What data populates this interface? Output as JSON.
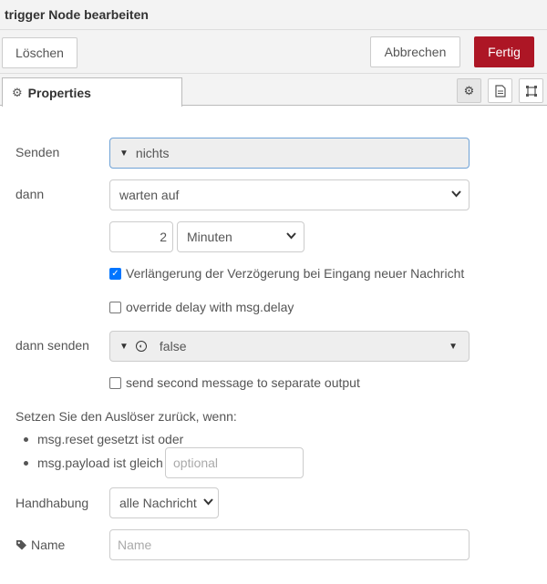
{
  "window": {
    "title": "trigger Node bearbeiten"
  },
  "toolbar": {
    "delete_label": "Löschen",
    "cancel_label": "Abbrechen",
    "done_label": "Fertig",
    "done_color": "#ad1625"
  },
  "tabs": {
    "properties_label": "Properties"
  },
  "form": {
    "send_label": "Senden",
    "send_value": "nichts",
    "then_label": "dann",
    "then_value": "warten auf",
    "delay_amount": "2",
    "delay_unit": "Minuten",
    "extend_label": "Verlängerung der Verzögerung bei Eingang neuer Nachricht",
    "extend_checked": true,
    "override_label": "override delay with msg.delay",
    "override_checked": false,
    "then_send_label": "dann senden",
    "then_send_value": "false",
    "second_output_label": "send second message to separate output",
    "second_output_checked": false,
    "reset_heading": "Setzen Sie den Auslöser zurück, wenn:",
    "reset_item1": "msg.reset gesetzt ist oder",
    "reset_item2": "msg.payload ist gleich",
    "reset_placeholder": "optional",
    "handling_label": "Handhabung",
    "handling_value": "alle Nachricht",
    "name_label": "Name",
    "name_placeholder": "Name"
  }
}
